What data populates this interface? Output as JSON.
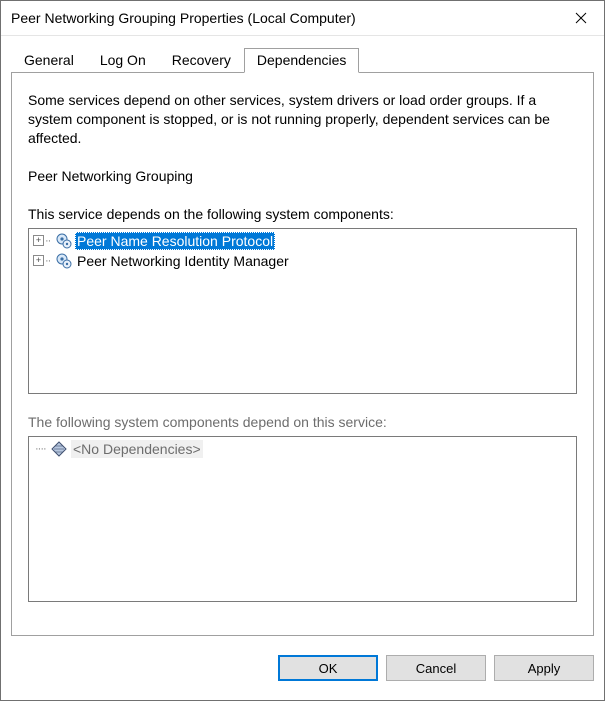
{
  "window": {
    "title": "Peer Networking Grouping Properties (Local Computer)"
  },
  "tabs": {
    "general": "General",
    "logon": "Log On",
    "recovery": "Recovery",
    "dependencies": "Dependencies"
  },
  "page": {
    "description": "Some services depend on other services, system drivers or load order groups. If a system component is stopped, or is not running properly, dependent services can be affected.",
    "service_name": "Peer Networking Grouping",
    "depends_label": "This service depends on the following system components:",
    "dependents_label": "The following system components depend on this service:",
    "depends_on": [
      {
        "label": "Peer Name Resolution Protocol",
        "selected": true
      },
      {
        "label": "Peer Networking Identity Manager",
        "selected": false
      }
    ],
    "dependents": [
      {
        "label": "<No Dependencies>"
      }
    ]
  },
  "buttons": {
    "ok": "OK",
    "cancel": "Cancel",
    "apply": "Apply"
  }
}
